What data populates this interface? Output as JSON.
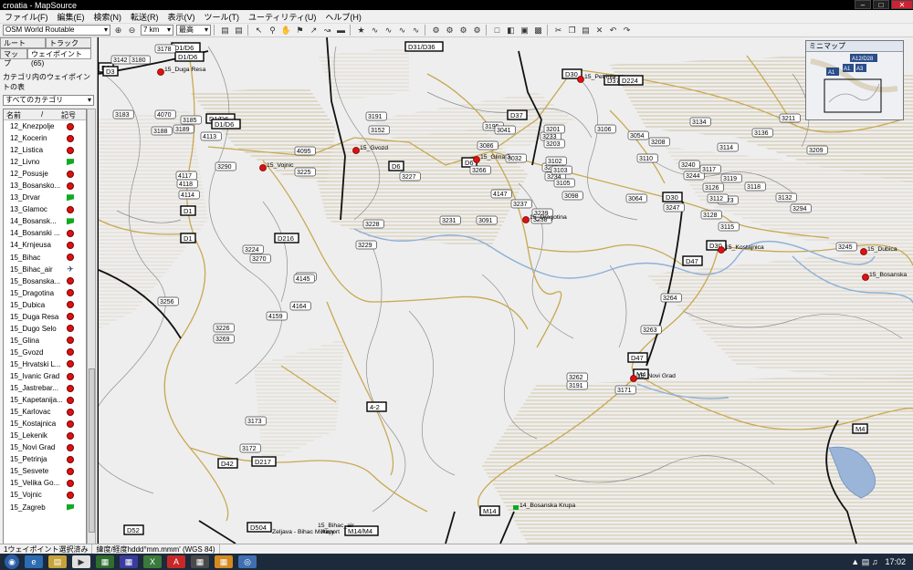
{
  "window": {
    "title": "croatia - MapSource"
  },
  "menu": [
    "ファイル(F)",
    "編集(E)",
    "検索(N)",
    "転送(R)",
    "表示(V)",
    "ツール(T)",
    "ユーティリティ(U)",
    "ヘルプ(H)"
  ],
  "toolbar": {
    "map_product": "OSM World Routable",
    "zoom_scale": "7 km",
    "detail": "最高"
  },
  "tabs": {
    "routes": "ルート",
    "tracks": "トラック",
    "maps": "マップ",
    "waypoints": "ウェイポイント (65)"
  },
  "panel": {
    "category_label": "カテゴリ内のウェイポイントの表",
    "category_value": "すべてのカテゴリ",
    "col_name": "名前",
    "col_sort": "/",
    "col_symbol": "記号"
  },
  "waypoints": [
    {
      "name": "12_Knezpolje",
      "icon": "pin"
    },
    {
      "name": "12_Kocerin",
      "icon": "pin"
    },
    {
      "name": "12_Listica",
      "icon": "pin"
    },
    {
      "name": "12_Livno",
      "icon": "flag"
    },
    {
      "name": "12_Posusje",
      "icon": "pin"
    },
    {
      "name": "13_Bosansko...",
      "icon": "pin"
    },
    {
      "name": "13_Drvar",
      "icon": "flag"
    },
    {
      "name": "13_Glamoc",
      "icon": "pin"
    },
    {
      "name": "14_Bosansk...",
      "icon": "flag"
    },
    {
      "name": "14_Bosanski ...",
      "icon": "pin"
    },
    {
      "name": "14_Krnjeusa",
      "icon": "pin"
    },
    {
      "name": "15_Bihac",
      "icon": "pin"
    },
    {
      "name": "15_Bihac_air",
      "icon": "plane"
    },
    {
      "name": "15_Bosanska...",
      "icon": "pin"
    },
    {
      "name": "15_Dragotina",
      "icon": "pin"
    },
    {
      "name": "15_Dubica",
      "icon": "pin"
    },
    {
      "name": "15_Duga Resa",
      "icon": "pin"
    },
    {
      "name": "15_Dugo Selo",
      "icon": "pin"
    },
    {
      "name": "15_Glina",
      "icon": "pin"
    },
    {
      "name": "15_Gvozd",
      "icon": "pin"
    },
    {
      "name": "15_Hrvatski L...",
      "icon": "pin"
    },
    {
      "name": "15_Ivanic Grad",
      "icon": "pin"
    },
    {
      "name": "15_Jastrebar...",
      "icon": "pin"
    },
    {
      "name": "15_Kapetanija...",
      "icon": "pin"
    },
    {
      "name": "15_Karlovac",
      "icon": "pin"
    },
    {
      "name": "15_Kostajnica",
      "icon": "pin"
    },
    {
      "name": "15_Lekenik",
      "icon": "pin"
    },
    {
      "name": "15_Novi Grad",
      "icon": "pin"
    },
    {
      "name": "15_Petrinja",
      "icon": "pin"
    },
    {
      "name": "15_Sesvete",
      "icon": "pin"
    },
    {
      "name": "15_Velika Go...",
      "icon": "pin"
    },
    {
      "name": "15_Vojnic",
      "icon": "pin"
    },
    {
      "name": "15_Zagreb",
      "icon": "flag"
    }
  ],
  "map": {
    "shields": [
      "D3",
      "D3",
      "D1/D6",
      "D1/D6",
      "D1/D6",
      "D1/D6",
      "D1",
      "D1",
      "D31/D36",
      "D37",
      "D30",
      "D37",
      "D224",
      "D6",
      "D6",
      "D216",
      "D30",
      "D30",
      "D47",
      "D47",
      "M4",
      "M4",
      "D42",
      "D217",
      "D504",
      "D52",
      "M14",
      "M14/M4",
      "4-2",
      "A1",
      "A1",
      "A3",
      "A12/D28"
    ],
    "roads": [
      "3142",
      "3180",
      "3178",
      "3183",
      "3185",
      "3189",
      "3188",
      "4070",
      "4113",
      "4117",
      "4118",
      "4114",
      "3290",
      "3225",
      "3271",
      "3256",
      "4164",
      "4145",
      "3224",
      "3270",
      "3226",
      "3228",
      "3229",
      "3227",
      "4095",
      "3191",
      "3152",
      "3195",
      "3041",
      "3032",
      "3233",
      "3234",
      "3235",
      "3237",
      "3238",
      "3231",
      "3239",
      "3091",
      "3098",
      "3201",
      "3203",
      "3102",
      "3103",
      "3105",
      "3106",
      "3054",
      "3208",
      "3064",
      "3110",
      "3240",
      "3244",
      "3117",
      "3119",
      "3126",
      "3123",
      "3118",
      "3128",
      "3114",
      "3115",
      "3134",
      "3211",
      "3209",
      "3136",
      "3132",
      "3247",
      "3112",
      "3245",
      "3294",
      "3264",
      "3263",
      "3262",
      "3191",
      "3171",
      "3173",
      "3172",
      "3269",
      "4159",
      "3266",
      "4147",
      "3086",
      "3095",
      "3053"
    ],
    "places": [
      "15_Duga Resa",
      "15_Vojnic",
      "15_Gvozd",
      "15_Glina 3",
      "15_Petrinja",
      "15_Dragotina",
      "15_Kostajnica",
      "15_Dubica",
      "15_Bosanska",
      "15_Novi Grad",
      "14_Bosanska Krupa",
      "15_Bihac_air",
      "Airport",
      "Zeljava - Bihac Military"
    ]
  },
  "minimap": {
    "title": "ミニマップ"
  },
  "status": {
    "selection": "1ウェイポイント選択済み",
    "coords": "緯度/経度hddd°mm.mmm' (WGS 84)"
  },
  "taskbar": {
    "time": "17:02"
  }
}
